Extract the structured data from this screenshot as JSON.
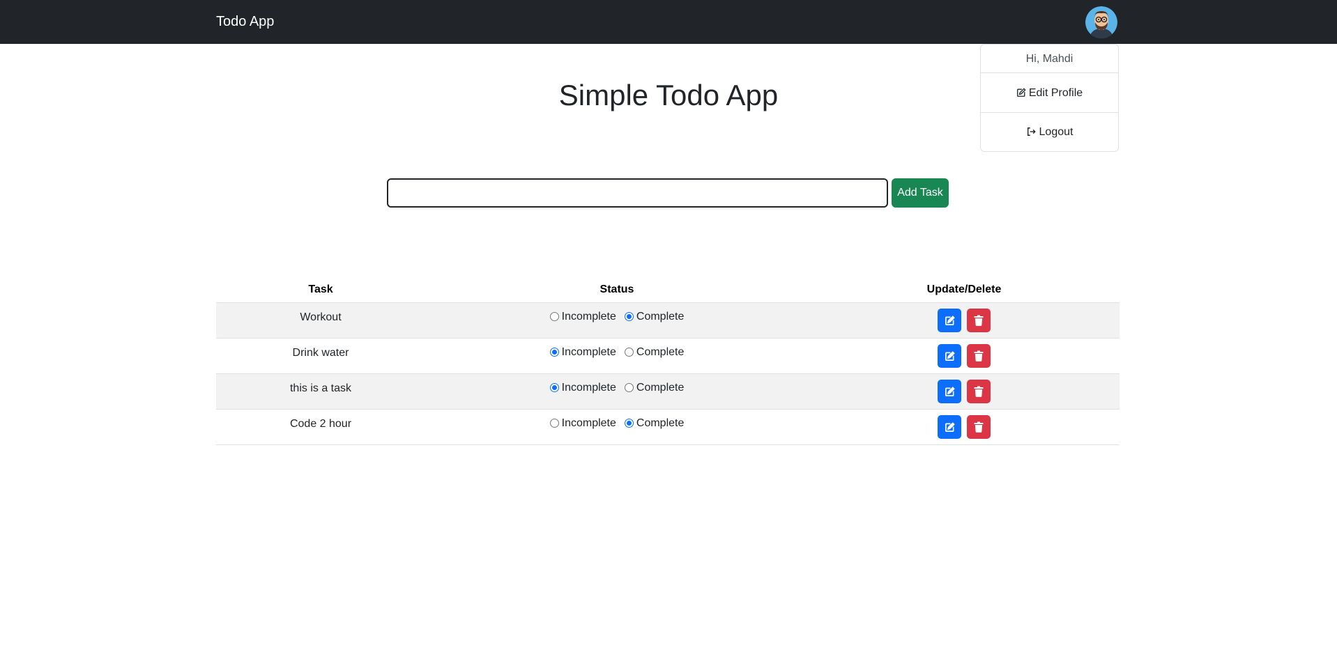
{
  "navbar": {
    "brand": "Todo App",
    "avatar_icon": "user-avatar-icon"
  },
  "user_menu": {
    "greeting": "Hi, Mahdi",
    "edit_profile": "Edit Profile",
    "logout": "Logout"
  },
  "main": {
    "title": "Simple Todo App",
    "input": {
      "value": "",
      "placeholder": ""
    },
    "add_button": "Add Task"
  },
  "table": {
    "headers": [
      "Task",
      "Status",
      "Update/Delete"
    ],
    "status_options": [
      "Incomplete",
      "Complete"
    ],
    "rows": [
      {
        "task": "Workout",
        "status": "Complete"
      },
      {
        "task": "Drink water",
        "status": "Incomplete"
      },
      {
        "task": "this is a task",
        "status": "Incomplete"
      },
      {
        "task": "Code 2 hour",
        "status": "Complete"
      }
    ]
  },
  "colors": {
    "navbar": "#212529",
    "add_button": "#198754",
    "edit_button": "#0d6efd",
    "delete_button": "#dc3545"
  }
}
